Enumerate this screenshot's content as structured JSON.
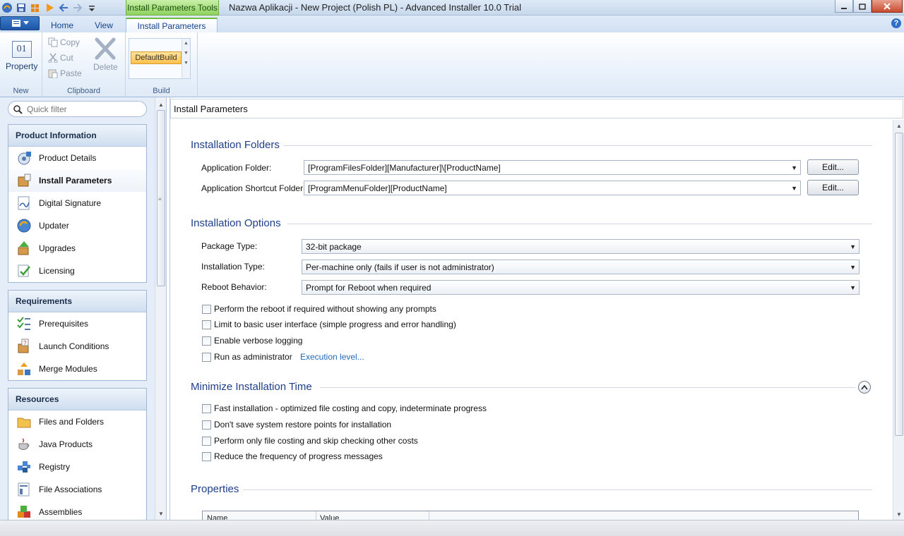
{
  "window": {
    "title": "Nazwa Aplikacji - New Project (Polish PL) - Advanced Installer 10.0 Trial",
    "context_tab": "Install Parameters Tools"
  },
  "tabs": [
    {
      "label": "Home"
    },
    {
      "label": "View"
    },
    {
      "label": "Install Parameters"
    }
  ],
  "ribbon": {
    "new": {
      "label": "New",
      "property_label": "Property",
      "property_icon_text": "01"
    },
    "clipboard": {
      "label": "Clipboard",
      "copy": "Copy",
      "cut": "Cut",
      "paste": "Paste",
      "delete": "Delete"
    },
    "build": {
      "label": "Build",
      "selected": "DefaultBuild"
    }
  },
  "sidebar": {
    "filter_placeholder": "Quick filter",
    "groups": [
      {
        "title": "Product Information",
        "items": [
          {
            "label": "Product Details",
            "icon": "product-details-icon"
          },
          {
            "label": "Install Parameters",
            "icon": "install-parameters-icon",
            "selected": true
          },
          {
            "label": "Digital Signature",
            "icon": "digital-signature-icon"
          },
          {
            "label": "Updater",
            "icon": "updater-icon"
          },
          {
            "label": "Upgrades",
            "icon": "upgrades-icon"
          },
          {
            "label": "Licensing",
            "icon": "licensing-icon"
          }
        ]
      },
      {
        "title": "Requirements",
        "items": [
          {
            "label": "Prerequisites",
            "icon": "prerequisites-icon"
          },
          {
            "label": "Launch Conditions",
            "icon": "launch-conditions-icon"
          },
          {
            "label": "Merge Modules",
            "icon": "merge-modules-icon"
          }
        ]
      },
      {
        "title": "Resources",
        "items": [
          {
            "label": "Files and Folders",
            "icon": "folder-icon"
          },
          {
            "label": "Java Products",
            "icon": "java-icon"
          },
          {
            "label": "Registry",
            "icon": "registry-icon"
          },
          {
            "label": "File Associations",
            "icon": "file-associations-icon"
          },
          {
            "label": "Assemblies",
            "icon": "assemblies-icon"
          }
        ]
      }
    ]
  },
  "main": {
    "header": "Install Parameters",
    "folders": {
      "title": "Installation Folders",
      "app_folder_label": "Application Folder:",
      "app_folder_value": "[ProgramFilesFolder][Manufacturer]\\[ProductName]",
      "shortcut_folder_label": "Application Shortcut Folder:",
      "shortcut_folder_value": "[ProgramMenuFolder][ProductName]",
      "edit_label": "Edit..."
    },
    "options": {
      "title": "Installation Options",
      "package_type_label": "Package Type:",
      "package_type_value": "32-bit package",
      "install_type_label": "Installation Type:",
      "install_type_value": "Per-machine only (fails if user is not administrator)",
      "reboot_label": "Reboot Behavior:",
      "reboot_value": "Prompt for Reboot when required",
      "check_reboot": "Perform the reboot if required without showing any prompts",
      "check_basic_ui": "Limit to basic user interface (simple progress and error handling)",
      "check_verbose": "Enable verbose logging",
      "check_admin": "Run as administrator",
      "execution_level_link": "Execution level..."
    },
    "minimize": {
      "title": "Minimize Installation Time",
      "check_fast": "Fast installation - optimized file costing and copy, indeterminate progress",
      "check_restore": "Don't save system restore points for installation",
      "check_costing": "Perform only file costing and skip checking other costs",
      "check_progress": "Reduce the frequency of progress messages"
    },
    "properties": {
      "title": "Properties",
      "col_name": "Name",
      "col_value": "Value"
    }
  },
  "colors": {
    "accent": "#1f3f8a",
    "context_green": "#8fd25e",
    "link": "#1e6bb8"
  }
}
